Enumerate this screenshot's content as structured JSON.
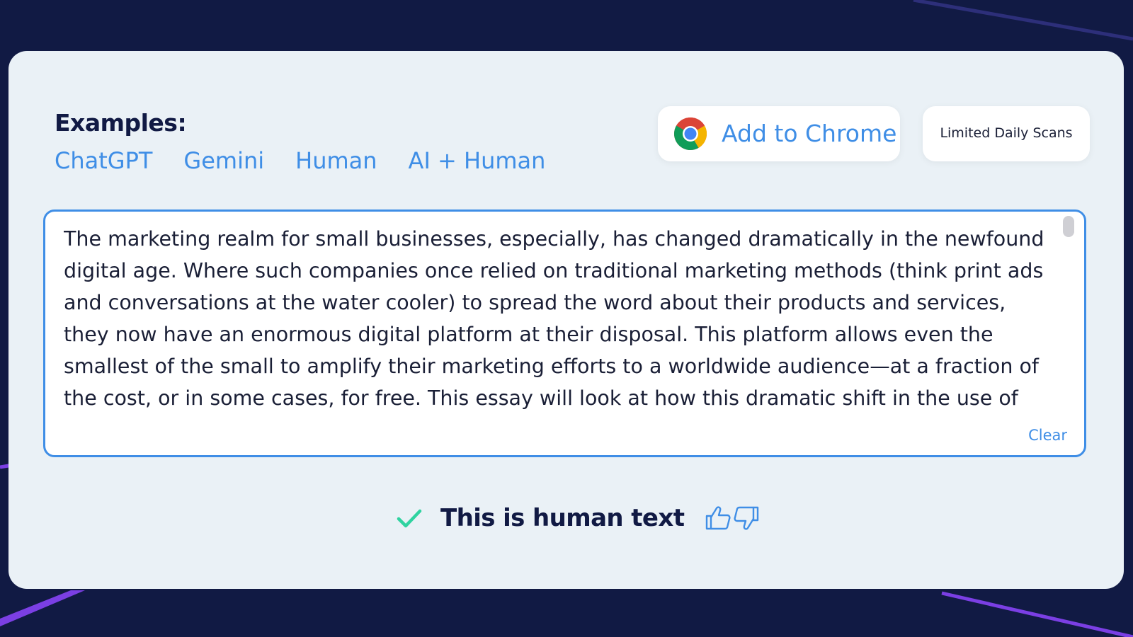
{
  "examples": {
    "title": "Examples:",
    "links": [
      "ChatGPT",
      "Gemini",
      "Human",
      "AI + Human"
    ]
  },
  "toolbar": {
    "add_to_chrome_label": "Add to Chrome",
    "add_to_chrome_icon": "chrome-icon",
    "limited_scans_label": "Limited Daily Scans"
  },
  "input": {
    "text": "The marketing realm for small businesses, especially, has changed dramatically in the newfound digital age. Where such companies once relied on traditional marketing methods (think print ads and conversations at the water cooler) to spread the word about their products and services, they now have an enormous digital platform at their disposal. This platform allows even the smallest of the small to amplify their marketing efforts to a worldwide audience—at a fraction of the cost, or in some cases, for free. This essay will look at how this dramatic shift in the use of digital marketing tools (or 'digitalization' as some",
    "clear_label": "Clear"
  },
  "result": {
    "icon": "check-icon",
    "text": "This is human text",
    "thumbs_up_icon": "thumbs-up-icon",
    "thumbs_down_icon": "thumbs-down-icon"
  },
  "colors": {
    "background": "#111a44",
    "panel": "#eaf1f6",
    "accent": "#3f8ee6",
    "success": "#2fd3a0",
    "decor_purple": "#7b3fe4"
  }
}
